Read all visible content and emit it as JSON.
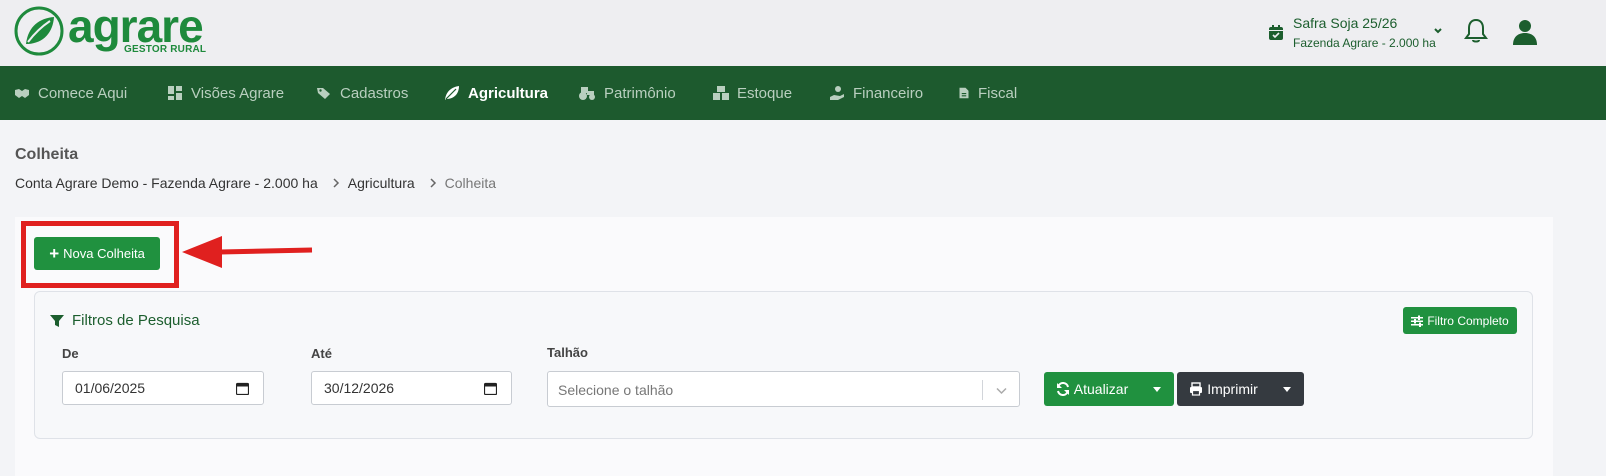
{
  "logo": {
    "word": "agrare",
    "tagline": "GESTOR RURAL",
    "brand_color": "#1e8a3c"
  },
  "header": {
    "season_title": "Safra Soja 25/26",
    "season_farm": "Fazenda Agrare - 2.000 ha",
    "icons": [
      "calendar-check-icon",
      "chevron-down-icon",
      "bell-icon",
      "user-icon"
    ]
  },
  "nav": {
    "items": [
      {
        "label": "Comece Aqui",
        "icon": "handshake-icon"
      },
      {
        "label": "Visões Agrare",
        "icon": "dashboard-icon"
      },
      {
        "label": "Cadastros",
        "icon": "tags-icon"
      },
      {
        "label": "Agricultura",
        "icon": "leaf-icon",
        "active": true
      },
      {
        "label": "Patrimônio",
        "icon": "tractor-icon"
      },
      {
        "label": "Estoque",
        "icon": "boxes-icon"
      },
      {
        "label": "Financeiro",
        "icon": "hand-coin-icon"
      },
      {
        "label": "Fiscal",
        "icon": "file-invoice-icon"
      }
    ],
    "bg_color": "#1d5a2e"
  },
  "page": {
    "title": "Colheita",
    "breadcrumb": [
      "Conta Agrare Demo - Fazenda Agrare - 2.000 ha",
      "Agricultura",
      "Colheita"
    ]
  },
  "actions": {
    "new_label": "Nova Colheita"
  },
  "filters": {
    "title": "Filtros de Pesquisa",
    "full_filter_label": "Filtro Completo",
    "from_label": "De",
    "from_value": "01/06/2025",
    "to_label": "Até",
    "to_value": "30/12/2026",
    "plot_label": "Talhão",
    "plot_placeholder": "Selecione o talhão",
    "refresh_label": "Atualizar",
    "print_label": "Imprimir"
  },
  "annotation_color": "#e0201f"
}
